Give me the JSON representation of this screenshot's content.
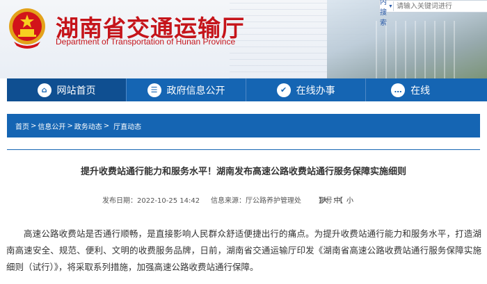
{
  "header": {
    "title": "湖南省交通运输厅",
    "subtitle": "Department of Transportation of Hunan Province",
    "search": {
      "select_label": "站内搜索",
      "placeholder": "请输入关键词进行"
    }
  },
  "nav": {
    "items": [
      {
        "label": "网站首页",
        "icon": "home-icon"
      },
      {
        "label": "政府信息公开",
        "icon": "document-icon"
      },
      {
        "label": "在线办事",
        "icon": "service-icon"
      },
      {
        "label": "在线",
        "icon": "chat-icon"
      }
    ]
  },
  "breadcrumb": [
    "首页",
    "信息公开",
    "政务动态",
    "厅直动态"
  ],
  "breadcrumb_sep": ">",
  "article": {
    "title": "提升收费站通行能力和服务水平！湖南发布高速公路收费站通行服务保障实施细则",
    "published": "发布日期：2022-10-25 14:42",
    "source": "信息来源：厅公路养护管理处",
    "font_size_label": "字号：【",
    "font_sizes": [
      "大",
      "中",
      "小"
    ],
    "font_size_end": "】",
    "body": "高速公路收费站是否通行顺畅，是直接影响人民群众舒适便捷出行的痛点。为提升收费站通行能力和服务水平，打造湖南高速安全、规范、便利、文明的收费服务品牌，日前，湖南省交通运输厅印发《湖南省高速公路收费站通行服务保障实施细则（试行）》，将采取系列措施，加强高速公路收费站通行保障。"
  },
  "colors": {
    "brand_red": "#c5141a",
    "nav_blue": "#1565b3"
  }
}
